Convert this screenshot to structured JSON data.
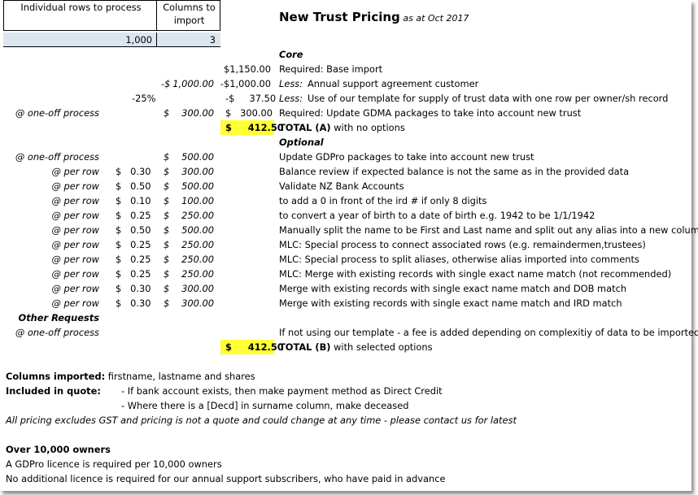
{
  "inputs": {
    "rows_label": "Individual rows to process",
    "rows_value": "1,000",
    "cols_label_line1": "Columns to",
    "cols_label_line2": "import",
    "cols_value": "3"
  },
  "title": {
    "main": "New Trust Pricing",
    "sub": "as at Oct 2017"
  },
  "sections": {
    "core": "Core",
    "optional": "Optional",
    "other": "Other Requests"
  },
  "core_rows": [
    {
      "label": "",
      "pct": "",
      "rate": "",
      "col_d": "",
      "col_e": "",
      "amount": "$1,150.00",
      "prefix": "",
      "desc": "Required: Base import"
    },
    {
      "label": "",
      "pct": "",
      "rate": "",
      "col_d": "-$",
      "col_e": "1,000.00",
      "amount": "-$1,000.00",
      "prefix": "Less:",
      "desc": "Annual support agreement customer"
    },
    {
      "label": "",
      "pct": "-25%",
      "rate": "",
      "col_d": "",
      "col_e": "",
      "amount": "-$     37.50",
      "prefix": "Less:",
      "desc": "Use of our template for supply of trust data with one row per owner/sh record"
    },
    {
      "label": "@ one-off process",
      "pct": "",
      "rate": "",
      "col_d": "$",
      "col_e": "300.00",
      "amount": "$   300.00",
      "prefix": "",
      "desc": "Required: Update GDMA packages to take into account new trust"
    }
  ],
  "total_a": {
    "amount": "$     412.50",
    "label": "TOTAL (A)",
    "suffix": "with no options"
  },
  "optional_rows": [
    {
      "label": "@ one-off process",
      "rate": "",
      "col_d": "$",
      "col_e": "500.00",
      "desc": "Update GDPro packages to take into account new trust"
    },
    {
      "label": "@ per row",
      "rate": "$   0.30",
      "col_d": "$",
      "col_e": "300.00",
      "desc": "Balance review if expected balance is not the same as in the provided data"
    },
    {
      "label": "@ per row",
      "rate": "$   0.50",
      "col_d": "$",
      "col_e": "500.00",
      "desc": "Validate NZ Bank Accounts"
    },
    {
      "label": "@ per row",
      "rate": "$   0.10",
      "col_d": "$",
      "col_e": "100.00",
      "desc": "to add a 0 in front of the ird # if only 8 digits"
    },
    {
      "label": "@ per row",
      "rate": "$   0.25",
      "col_d": "$",
      "col_e": "250.00",
      "desc": "to convert a year of birth to a date of birth e.g. 1942 to be 1/1/1942"
    },
    {
      "label": "@ per row",
      "rate": "$   0.50",
      "col_d": "$",
      "col_e": "500.00",
      "desc": "Manually split the name to be First and Last name and split out any alias into a new column"
    },
    {
      "label": "@ per row",
      "rate": "$   0.25",
      "col_d": "$",
      "col_e": "250.00",
      "desc": "MLC: Special process to connect associated rows (e.g. remaindermen,trustees)"
    },
    {
      "label": "@ per row",
      "rate": "$   0.25",
      "col_d": "$",
      "col_e": "250.00",
      "desc": "MLC: Special process to split aliases, otherwise alias imported into comments"
    },
    {
      "label": "@ per row",
      "rate": "$   0.25",
      "col_d": "$",
      "col_e": "250.00",
      "desc": "MLC: Merge with existing records with single exact name match (not recommended)"
    },
    {
      "label": "@ per row",
      "rate": "$   0.30",
      "col_d": "$",
      "col_e": "300.00",
      "desc": "Merge with existing records with single exact name match and DOB match"
    },
    {
      "label": "@ per row",
      "rate": "$   0.30",
      "col_d": "$",
      "col_e": "300.00",
      "desc": "Merge with existing records with single exact name match and IRD match"
    }
  ],
  "other_rows": [
    {
      "label": "@ one-off process",
      "desc": "If not using our template - a fee is added depending on complexitiy of data to be imported"
    }
  ],
  "total_b": {
    "amount": "$     412.50",
    "label": "TOTAL (B)",
    "suffix": "with selected options"
  },
  "notes": {
    "columns_label": "Columns imported:",
    "columns_value": "firstname, lastname and shares",
    "included_label": "Included in quote:",
    "included_1": "- If bank account exists, then make payment method as Direct Credit",
    "included_2": "- Where there is a [Decd] in surname column, make deceased",
    "disclaimer": "All pricing excludes GST and pricing is not a quote and could change at any time - please contact us for latest",
    "over_heading": "Over 10,000 owners",
    "over_1": "A GDPro licence is required per 10,000 owners",
    "over_2": "No additional licence is required for our annual support subscribers, who have paid in advance"
  }
}
